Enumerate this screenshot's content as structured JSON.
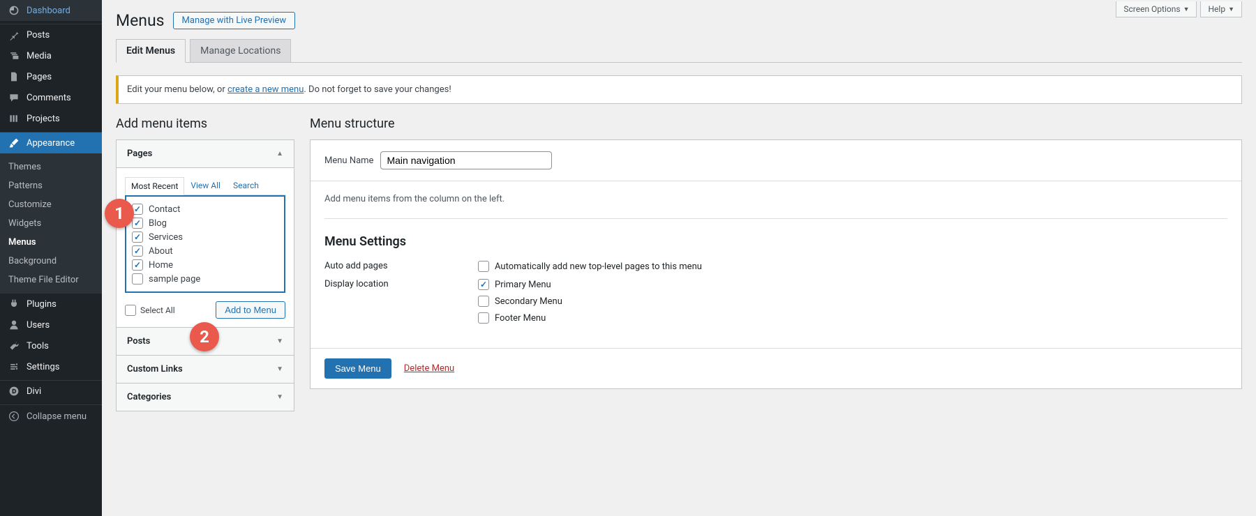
{
  "screenOptions": "Screen Options",
  "help": "Help",
  "sidebar": {
    "items": [
      {
        "label": "Dashboard"
      },
      {
        "label": "Posts"
      },
      {
        "label": "Media"
      },
      {
        "label": "Pages"
      },
      {
        "label": "Comments"
      },
      {
        "label": "Projects"
      },
      {
        "label": "Appearance"
      },
      {
        "label": "Plugins"
      },
      {
        "label": "Users"
      },
      {
        "label": "Tools"
      },
      {
        "label": "Settings"
      },
      {
        "label": "Divi"
      }
    ],
    "submenu": [
      {
        "label": "Themes"
      },
      {
        "label": "Patterns"
      },
      {
        "label": "Customize"
      },
      {
        "label": "Widgets"
      },
      {
        "label": "Menus"
      },
      {
        "label": "Background"
      },
      {
        "label": "Theme File Editor"
      }
    ],
    "collapse": "Collapse menu"
  },
  "page": {
    "title": "Menus",
    "livePreview": "Manage with Live Preview"
  },
  "tabs": {
    "edit": "Edit Menus",
    "locations": "Manage Locations"
  },
  "notice": {
    "part1": "Edit your menu below, or ",
    "link": "create a new menu",
    "part2": ". Do not forget to save your changes!"
  },
  "addItems": {
    "heading": "Add menu items",
    "sections": [
      {
        "label": "Pages"
      },
      {
        "label": "Posts"
      },
      {
        "label": "Custom Links"
      },
      {
        "label": "Categories"
      }
    ],
    "innerTabs": {
      "recent": "Most Recent",
      "all": "View All",
      "search": "Search"
    },
    "pages": [
      {
        "label": "Contact",
        "checked": true
      },
      {
        "label": "Blog",
        "checked": true
      },
      {
        "label": "Services",
        "checked": true
      },
      {
        "label": "About",
        "checked": true
      },
      {
        "label": "Home",
        "checked": true
      },
      {
        "label": "sample page",
        "checked": false
      }
    ],
    "selectAll": "Select All",
    "addToMenu": "Add to Menu"
  },
  "menuStructure": {
    "heading": "Menu structure",
    "nameLabel": "Menu Name",
    "nameValue": "Main navigation",
    "emptyText": "Add menu items from the column on the left."
  },
  "menuSettings": {
    "heading": "Menu Settings",
    "autoAddLabel": "Auto add pages",
    "autoAddOption": "Automatically add new top-level pages to this menu",
    "displayLabel": "Display location",
    "locations": [
      {
        "label": "Primary Menu",
        "checked": true
      },
      {
        "label": "Secondary Menu",
        "checked": false
      },
      {
        "label": "Footer Menu",
        "checked": false
      }
    ]
  },
  "actions": {
    "save": "Save Menu",
    "delete": "Delete Menu"
  },
  "annotations": {
    "one": "1",
    "two": "2"
  }
}
